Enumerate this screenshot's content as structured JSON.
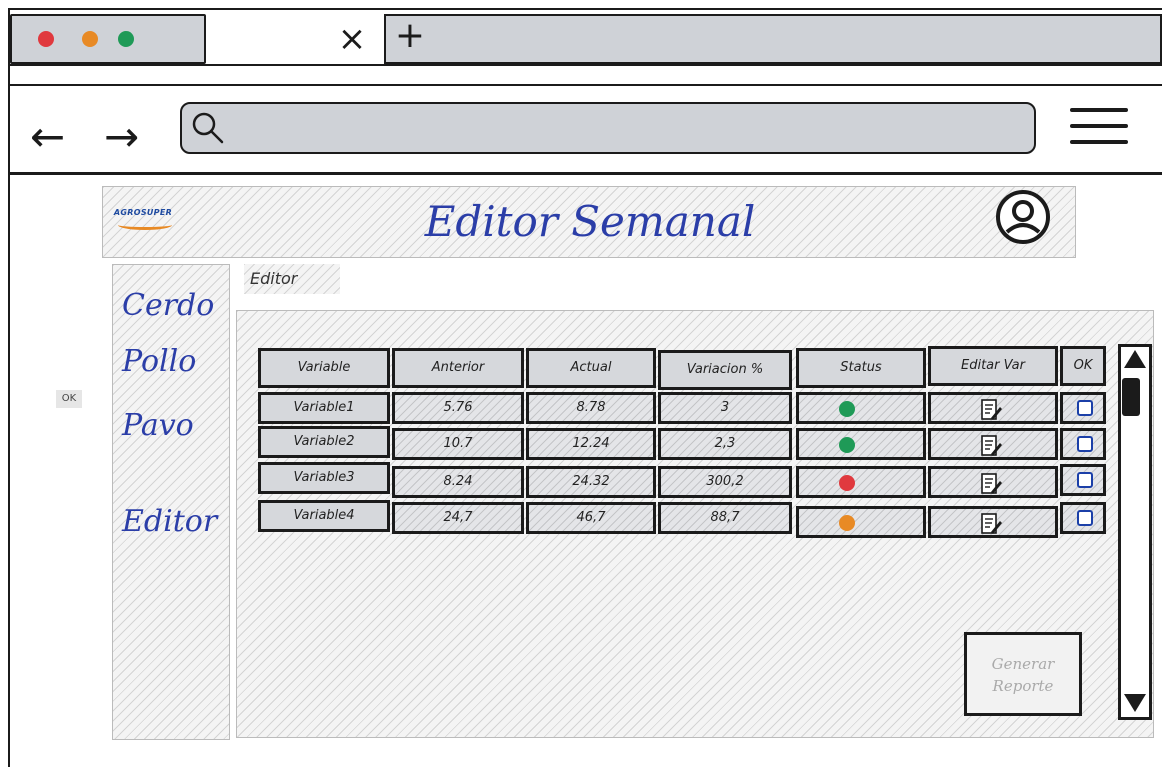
{
  "browser": {
    "tab_close_glyph": "×",
    "new_tab_glyph": "+",
    "back_glyph": "←",
    "forward_glyph": "→",
    "window_dots": [
      "#e0393e",
      "#e88a25",
      "#1f9a57"
    ]
  },
  "header": {
    "logo_text": "AGROSUPER",
    "title": "Editor Semanal",
    "avatar_icon": "user-circle-icon"
  },
  "sidebar": {
    "items": [
      {
        "label": "Cerdo"
      },
      {
        "label": "Pollo"
      },
      {
        "label": "Pavo"
      },
      {
        "label": "Editor"
      }
    ],
    "ok_label": "OK"
  },
  "breadcrumb": "Editor",
  "table": {
    "headers": [
      "Variable",
      "Anterior",
      "Actual",
      "Variacion %",
      "Status",
      "Editar Var",
      "OK"
    ],
    "rows": [
      {
        "variable": "Variable1",
        "anterior": "5.76",
        "actual": "8.78",
        "variacion": "3",
        "status_color": "#1f9a57"
      },
      {
        "variable": "Variable2",
        "anterior": "10.7",
        "actual": "12.24",
        "variacion": "2,3",
        "status_color": "#1f9a57"
      },
      {
        "variable": "Variable3",
        "anterior": "8.24",
        "actual": "24.32",
        "variacion": "300,2",
        "status_color": "#e0393e"
      },
      {
        "variable": "Variable4",
        "anterior": "24,7",
        "actual": "46,7",
        "variacion": "88,7",
        "status_color": "#e88a25"
      }
    ]
  },
  "button": {
    "line1": "Generar",
    "line2": "Reporte"
  }
}
